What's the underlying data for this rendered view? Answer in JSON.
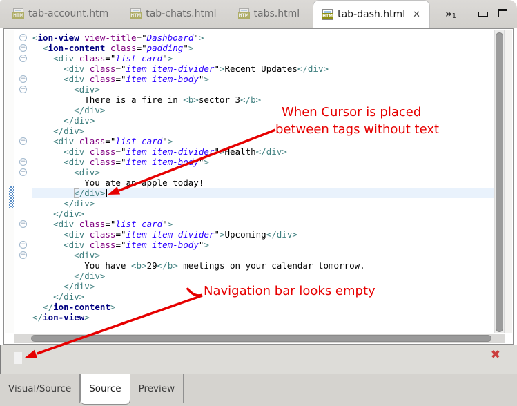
{
  "tab_bar": {
    "tabs": [
      {
        "label": "tab-account.htm",
        "active": false
      },
      {
        "label": "tab-chats.html",
        "active": false
      },
      {
        "label": "tabs.html",
        "active": false
      },
      {
        "label": "tab-dash.html",
        "active": true
      }
    ],
    "overflow": {
      "chevron": "»",
      "count": "1"
    },
    "close_icon": "✕",
    "file_icon_label": "HTM"
  },
  "editor": {
    "fold_icon": "−",
    "code_lines": [
      {
        "fold": true,
        "segments": [
          [
            "t",
            "<"
          ],
          [
            "c",
            "ion-view"
          ],
          [
            "x",
            " "
          ],
          [
            "a",
            "view-title"
          ],
          [
            "x",
            "=\""
          ],
          [
            "v",
            "Dashboard"
          ],
          [
            "x",
            "\""
          ],
          [
            "t",
            ">"
          ]
        ]
      },
      {
        "fold": true,
        "segments": [
          [
            "x",
            "  "
          ],
          [
            "t",
            "<"
          ],
          [
            "c",
            "ion-content"
          ],
          [
            "x",
            " "
          ],
          [
            "a",
            "class"
          ],
          [
            "x",
            "=\""
          ],
          [
            "v",
            "padding"
          ],
          [
            "x",
            "\""
          ],
          [
            "t",
            ">"
          ]
        ]
      },
      {
        "fold": true,
        "segments": [
          [
            "x",
            "    "
          ],
          [
            "t",
            "<div"
          ],
          [
            "x",
            " "
          ],
          [
            "a",
            "class"
          ],
          [
            "x",
            "=\""
          ],
          [
            "v",
            "list card"
          ],
          [
            "x",
            "\""
          ],
          [
            "t",
            ">"
          ]
        ]
      },
      {
        "segments": [
          [
            "x",
            "      "
          ],
          [
            "t",
            "<div"
          ],
          [
            "x",
            " "
          ],
          [
            "a",
            "class"
          ],
          [
            "x",
            "=\""
          ],
          [
            "v",
            "item item-divider"
          ],
          [
            "x",
            "\""
          ],
          [
            "t",
            ">"
          ],
          [
            "x",
            "Recent Updates"
          ],
          [
            "t",
            "</div>"
          ]
        ]
      },
      {
        "fold": true,
        "segments": [
          [
            "x",
            "      "
          ],
          [
            "t",
            "<div"
          ],
          [
            "x",
            " "
          ],
          [
            "a",
            "class"
          ],
          [
            "x",
            "=\""
          ],
          [
            "v",
            "item item-body"
          ],
          [
            "x",
            "\""
          ],
          [
            "t",
            ">"
          ]
        ]
      },
      {
        "fold": true,
        "segments": [
          [
            "x",
            "        "
          ],
          [
            "t",
            "<div>"
          ]
        ]
      },
      {
        "segments": [
          [
            "x",
            "          There is a fire in "
          ],
          [
            "t",
            "<b>"
          ],
          [
            "x",
            "sector 3"
          ],
          [
            "t",
            "</b>"
          ]
        ]
      },
      {
        "segments": [
          [
            "x",
            "        "
          ],
          [
            "t",
            "</div>"
          ]
        ]
      },
      {
        "segments": [
          [
            "x",
            "      "
          ],
          [
            "t",
            "</div>"
          ]
        ]
      },
      {
        "segments": [
          [
            "x",
            "    "
          ],
          [
            "t",
            "</div>"
          ]
        ]
      },
      {
        "fold": true,
        "segments": [
          [
            "x",
            "    "
          ],
          [
            "t",
            "<div"
          ],
          [
            "x",
            " "
          ],
          [
            "a",
            "class"
          ],
          [
            "x",
            "=\""
          ],
          [
            "v",
            "list card"
          ],
          [
            "x",
            "\""
          ],
          [
            "t",
            ">"
          ]
        ]
      },
      {
        "segments": [
          [
            "x",
            "      "
          ],
          [
            "t",
            "<div"
          ],
          [
            "x",
            " "
          ],
          [
            "a",
            "class"
          ],
          [
            "x",
            "=\""
          ],
          [
            "v",
            "item item-divider"
          ],
          [
            "x",
            "\""
          ],
          [
            "t",
            ">"
          ],
          [
            "x",
            "Health"
          ],
          [
            "t",
            "</div>"
          ]
        ]
      },
      {
        "fold": true,
        "segments": [
          [
            "x",
            "      "
          ],
          [
            "t",
            "<div"
          ],
          [
            "x",
            " "
          ],
          [
            "a",
            "class"
          ],
          [
            "x",
            "=\""
          ],
          [
            "v",
            "item item-body"
          ],
          [
            "x",
            "\""
          ],
          [
            "t",
            ">"
          ]
        ]
      },
      {
        "fold": true,
        "segments": [
          [
            "x",
            "        "
          ],
          [
            "t",
            "<div>"
          ]
        ]
      },
      {
        "segments": [
          [
            "x",
            "          You ate an apple today!"
          ]
        ]
      },
      {
        "current": true,
        "cursor": true,
        "segments": [
          [
            "x",
            "        "
          ],
          [
            "bb",
            "<"
          ],
          [
            "t",
            "/div>"
          ]
        ]
      },
      {
        "segments": [
          [
            "x",
            "      "
          ],
          [
            "t",
            "</div>"
          ]
        ]
      },
      {
        "segments": [
          [
            "x",
            "    "
          ],
          [
            "t",
            "</div>"
          ]
        ]
      },
      {
        "fold": true,
        "segments": [
          [
            "x",
            "    "
          ],
          [
            "t",
            "<div"
          ],
          [
            "x",
            " "
          ],
          [
            "a",
            "class"
          ],
          [
            "x",
            "=\""
          ],
          [
            "v",
            "list card"
          ],
          [
            "x",
            "\""
          ],
          [
            "t",
            ">"
          ]
        ]
      },
      {
        "segments": [
          [
            "x",
            "      "
          ],
          [
            "t",
            "<div"
          ],
          [
            "x",
            " "
          ],
          [
            "a",
            "class"
          ],
          [
            "x",
            "=\""
          ],
          [
            "v",
            "item item-divider"
          ],
          [
            "x",
            "\""
          ],
          [
            "t",
            ">"
          ],
          [
            "x",
            "Upcoming"
          ],
          [
            "t",
            "</div>"
          ]
        ]
      },
      {
        "fold": true,
        "segments": [
          [
            "x",
            "      "
          ],
          [
            "t",
            "<div"
          ],
          [
            "x",
            " "
          ],
          [
            "a",
            "class"
          ],
          [
            "x",
            "=\""
          ],
          [
            "v",
            "item item-body"
          ],
          [
            "x",
            "\""
          ],
          [
            "t",
            ">"
          ]
        ]
      },
      {
        "fold": true,
        "segments": [
          [
            "x",
            "        "
          ],
          [
            "t",
            "<div>"
          ]
        ]
      },
      {
        "segments": [
          [
            "x",
            "          You have "
          ],
          [
            "t",
            "<b>"
          ],
          [
            "x",
            "29"
          ],
          [
            "t",
            "</b>"
          ],
          [
            "x",
            " meetings on your calendar tomorrow."
          ]
        ]
      },
      {
        "segments": [
          [
            "x",
            "        "
          ],
          [
            "t",
            "</div>"
          ]
        ]
      },
      {
        "segments": [
          [
            "x",
            "      "
          ],
          [
            "t",
            "</div>"
          ]
        ]
      },
      {
        "segments": [
          [
            "x",
            "    "
          ],
          [
            "t",
            "</div>"
          ]
        ]
      },
      {
        "segments": [
          [
            "x",
            "  "
          ],
          [
            "t",
            "</"
          ],
          [
            "c",
            "ion-content"
          ],
          [
            "t",
            ">"
          ]
        ]
      },
      {
        "segments": [
          [
            "t",
            "</"
          ],
          [
            "c",
            "ion-view"
          ],
          [
            "t",
            ">"
          ]
        ]
      }
    ]
  },
  "annotations": {
    "cursor_note_line1": "When Cursor is placed",
    "cursor_note_line2": "between tags without text",
    "nav_note": "Navigation bar looks empty",
    "color": "#e60000"
  },
  "nav_panel": {
    "close_icon": "✖"
  },
  "bottom_tabs": {
    "items": [
      {
        "label": "Visual/Source",
        "active": false
      },
      {
        "label": "Source",
        "active": true
      },
      {
        "label": "Preview",
        "active": false
      }
    ]
  },
  "colors": {
    "tag_teal": "#3F7F7F",
    "custom_tag_navy": "#000080",
    "attr_purple": "#7F007F",
    "attr_value_blue": "#2A00FF",
    "current_line_highlight": "#e9f2fc",
    "annotation_red": "#e60000"
  }
}
